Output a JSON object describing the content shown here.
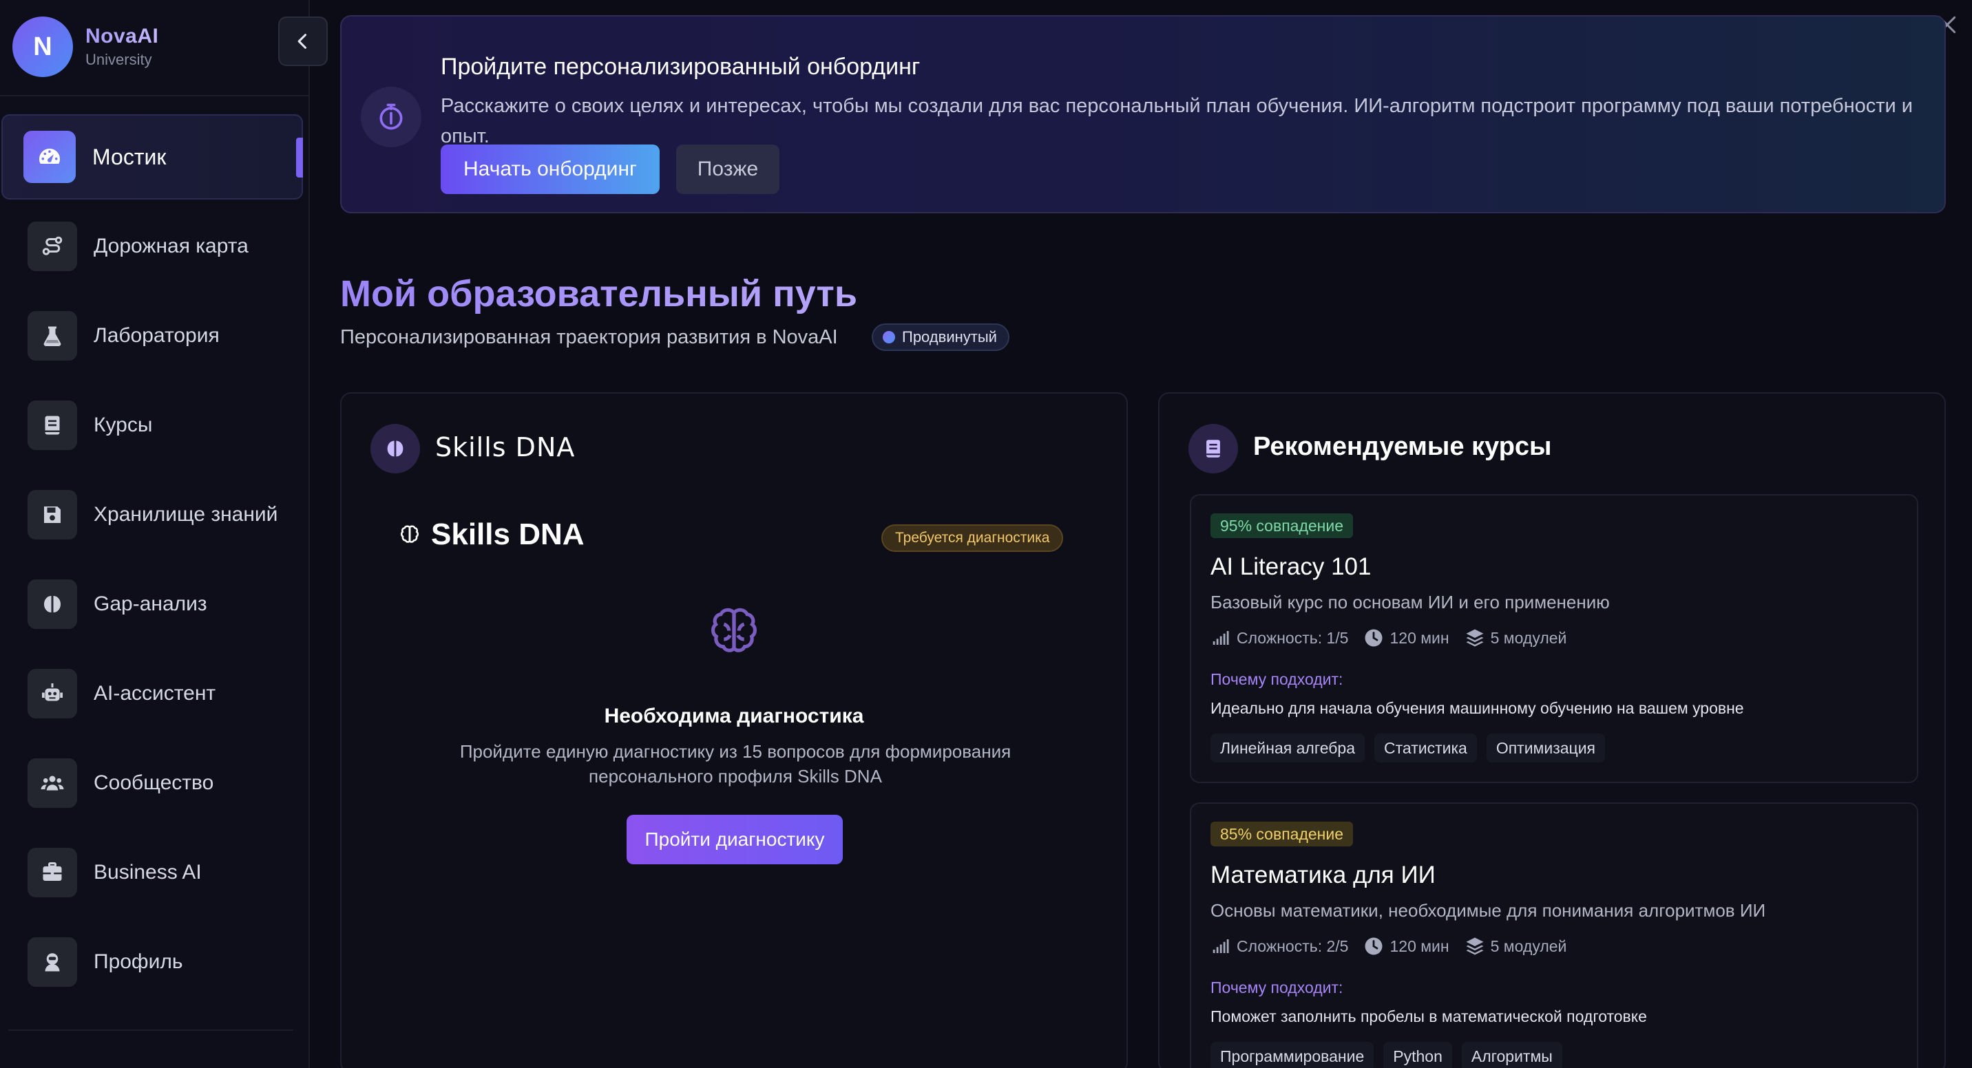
{
  "brand": {
    "initial": "N",
    "name": "NovaAI",
    "subtitle": "University"
  },
  "sidebar": {
    "items": [
      {
        "label": "Мостик",
        "icon": "dashboard-gauge-icon",
        "active": true
      },
      {
        "label": "Дорожная карта",
        "icon": "route-icon",
        "active": false
      },
      {
        "label": "Лаборатория",
        "icon": "flask-icon",
        "active": false
      },
      {
        "label": "Курсы",
        "icon": "book-icon",
        "active": false
      },
      {
        "label": "Хранилище знаний",
        "icon": "save-disk-icon",
        "active": false
      },
      {
        "label": "Gap-анализ",
        "icon": "brain-icon",
        "active": false
      },
      {
        "label": "AI-ассистент",
        "icon": "robot-icon",
        "active": false
      },
      {
        "label": "Сообщество",
        "icon": "users-icon",
        "active": false
      },
      {
        "label": "Business AI",
        "icon": "briefcase-icon",
        "active": false
      },
      {
        "label": "Профиль",
        "icon": "user-astronaut-icon",
        "active": false
      }
    ]
  },
  "onboarding": {
    "title": "Пройдите персонализированный онбординг",
    "description": "Расскажите о своих целях и интересах, чтобы мы создали для вас персональный план обучения. ИИ-алгоритм подстроит программу под ваши потребности и опыт.",
    "start_label": "Начать онбординг",
    "later_label": "Позже"
  },
  "page": {
    "title": "Мой образовательный путь",
    "subtitle": "Персонализированная траектория развития в NovaAI",
    "level": "Продвинутый"
  },
  "skills_card": {
    "header": "Skills DNA",
    "title": "Skills DNA",
    "status_badge": "Требуется диагностика",
    "need_title": "Необходима диагностика",
    "need_desc": "Пройдите единую диагностику из 15 вопросов для формирования персонального профиля Skills DNA",
    "button": "Пройти диагностику"
  },
  "recommended": {
    "header": "Рекомендуемые курсы",
    "courses": [
      {
        "match": "95% совпадение",
        "title": "AI Literacy 101",
        "desc": "Базовый курс по основам ИИ и его применению",
        "difficulty": "Сложность: 1/5",
        "duration": "120 мин",
        "modules": "5 модулей",
        "why_label": "Почему подходит:",
        "why_text": "Идеально для начала обучения машинному обучению на вашем уровне",
        "tags": [
          "Линейная алгебра",
          "Статистика",
          "Оптимизация"
        ]
      },
      {
        "match": "85% совпадение",
        "title": "Математика для ИИ",
        "desc": "Основы математики, необходимые для понимания алгоритмов ИИ",
        "difficulty": "Сложность: 2/5",
        "duration": "120 мин",
        "modules": "5 модулей",
        "why_label": "Почему подходит:",
        "why_text": "Поможет заполнить пробелы в математической подготовке",
        "tags": [
          "Программирование",
          "Python",
          "Алгоритмы"
        ]
      }
    ]
  },
  "colors": {
    "accent": "#7b5cf0",
    "accent_blue": "#4fa4ef",
    "background": "#0b0c16",
    "match_green": "#7fd9a7",
    "match_yellow": "#f0cf6a"
  }
}
